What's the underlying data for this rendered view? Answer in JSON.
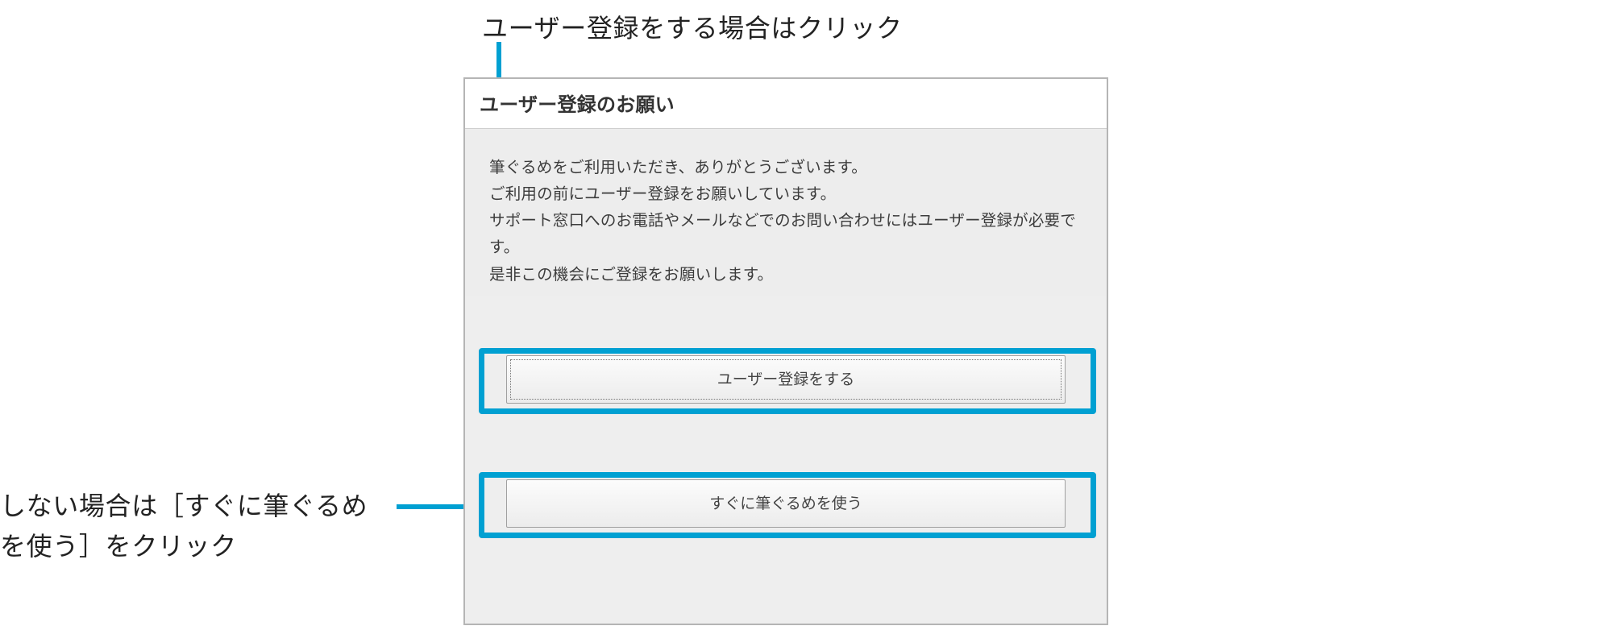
{
  "callouts": {
    "top": "ユーザー登録をする場合はクリック",
    "bottom_line1": "しない場合は［すぐに筆ぐるめ",
    "bottom_line2": "を使う］をクリック"
  },
  "dialog": {
    "title": "ユーザー登録のお願い",
    "body_lines": [
      "筆ぐるめをご利用いただき、ありがとうございます。",
      "ご利用の前にユーザー登録をお願いしています。",
      "サポート窓口へのお電話やメールなどでのお問い合わせにはユーザー登録が必要です。",
      "是非この機会にご登録をお願いします。"
    ],
    "buttons": {
      "register": "ユーザー登録をする",
      "use_now": "すぐに筆ぐるめを使う"
    }
  }
}
